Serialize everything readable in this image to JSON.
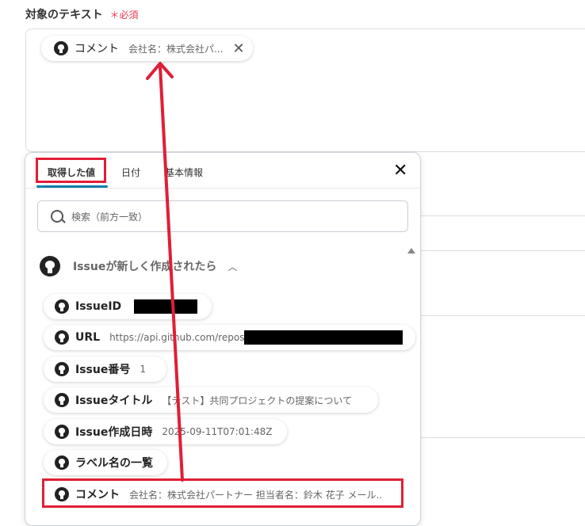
{
  "field": {
    "label": "対象のテキスト",
    "required_mark": "＊",
    "required_text": "必須"
  },
  "selected_chip": {
    "title": "コメント",
    "value": "会社名：株式会社パ..."
  },
  "panel": {
    "tabs": [
      "取得した値",
      "日付",
      "基本情報"
    ],
    "active_tab": "取得した値",
    "search_placeholder": "検索（前方一致）",
    "section_title": "Issueが新しく作成されたら",
    "items": [
      {
        "title": "IssueID",
        "value": ""
      },
      {
        "title": "URL",
        "value": "https://api.github.com/repos"
      },
      {
        "title": "Issue番号",
        "value": "1"
      },
      {
        "title": "Issueタイトル",
        "value": "【テスト】共同プロジェクトの提案について"
      },
      {
        "title": "Issue作成日時",
        "value": "2025-09-11T07:01:48Z"
      },
      {
        "title": "ラベル名の一覧",
        "value": ""
      },
      {
        "title": "コメント",
        "value": "会社名：株式会社パートナー 担当者名：鈴木 花子 メール..."
      }
    ]
  },
  "colors": {
    "required": "#e8384f",
    "highlight": "#e01e37",
    "tab_accent": "#0b7ea8"
  }
}
